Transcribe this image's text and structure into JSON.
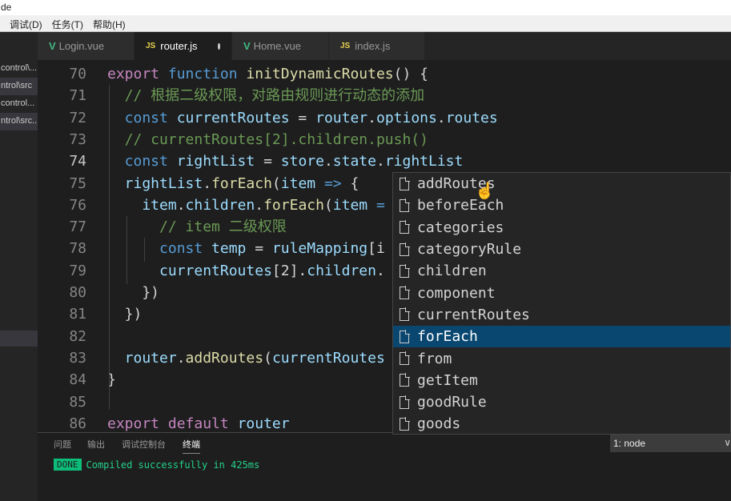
{
  "window": {
    "title": "de"
  },
  "menu": [
    "调试(D)",
    "任务(T)",
    "帮助(H)"
  ],
  "sidebar": [
    "control\\...",
    "ntrol\\src",
    "control...",
    "ntrol\\src..",
    "",
    ""
  ],
  "tabs": [
    {
      "label": "Login.vue",
      "icon": "vue-icon"
    },
    {
      "label": "router.js",
      "icon": "js-icon",
      "active": true,
      "modified": true
    },
    {
      "label": "Home.vue",
      "icon": "vue-icon"
    },
    {
      "label": "index.js",
      "icon": "js-icon"
    }
  ],
  "code": [
    {
      "n": "70",
      "t": [
        [
          "export ",
          "kw"
        ],
        [
          "function ",
          "bl"
        ],
        [
          "initDynamicRoutes",
          "fn"
        ],
        [
          "() {",
          "pn"
        ]
      ]
    },
    {
      "n": "71",
      "t": [
        [
          "  // 根据二级权限，对路由规则进行动态的添加",
          "cm"
        ]
      ]
    },
    {
      "n": "72",
      "t": [
        [
          "  const ",
          "bl"
        ],
        [
          "currentRoutes",
          "vr"
        ],
        [
          " = ",
          "pn"
        ],
        [
          "router",
          "vr"
        ],
        [
          ".",
          "pn"
        ],
        [
          "options",
          "vr"
        ],
        [
          ".",
          "pn"
        ],
        [
          "routes",
          "vr"
        ]
      ]
    },
    {
      "n": "73",
      "t": [
        [
          "  // currentRoutes[2].children.push()",
          "cm"
        ]
      ]
    },
    {
      "n": "74",
      "t": [
        [
          "  const ",
          "bl"
        ],
        [
          "rightList",
          "vr"
        ],
        [
          " = ",
          "pn"
        ],
        [
          "store",
          "vr"
        ],
        [
          ".",
          "pn"
        ],
        [
          "state",
          "vr"
        ],
        [
          ".",
          "pn"
        ],
        [
          "rightList",
          "vr"
        ]
      ],
      "current": true
    },
    {
      "n": "75",
      "t": [
        [
          "  rightList",
          "vr"
        ],
        [
          ".",
          "pn"
        ],
        [
          "forEach",
          "fn"
        ],
        [
          "(",
          "pn"
        ],
        [
          "item",
          "vr"
        ],
        [
          " => ",
          "bl"
        ],
        [
          "{",
          "pn"
        ]
      ]
    },
    {
      "n": "76",
      "t": [
        [
          "    item",
          "vr"
        ],
        [
          ".",
          "pn"
        ],
        [
          "children",
          "vr"
        ],
        [
          ".",
          "pn"
        ],
        [
          "forEach",
          "fn"
        ],
        [
          "(",
          "pn"
        ],
        [
          "item",
          "vr"
        ],
        [
          " =",
          "bl"
        ]
      ]
    },
    {
      "n": "77",
      "t": [
        [
          "      // item 二级权限",
          "cm"
        ]
      ]
    },
    {
      "n": "78",
      "t": [
        [
          "      const ",
          "bl"
        ],
        [
          "temp",
          "vr"
        ],
        [
          " = ",
          "pn"
        ],
        [
          "ruleMapping",
          "vr"
        ],
        [
          "[i",
          "pn"
        ]
      ]
    },
    {
      "n": "79",
      "t": [
        [
          "      currentRoutes",
          "vr"
        ],
        [
          "[2].",
          "pn"
        ],
        [
          "children",
          "vr"
        ],
        [
          ".",
          "pn"
        ]
      ]
    },
    {
      "n": "80",
      "t": [
        [
          "    })",
          "pn"
        ]
      ]
    },
    {
      "n": "81",
      "t": [
        [
          "  })",
          "pn"
        ]
      ]
    },
    {
      "n": "82",
      "t": [
        [
          "",
          "pn"
        ]
      ]
    },
    {
      "n": "83",
      "t": [
        [
          "  router",
          "vr"
        ],
        [
          ".",
          "pn"
        ],
        [
          "addRoutes",
          "fn"
        ],
        [
          "(",
          "pn"
        ],
        [
          "currentRoutes",
          "vr"
        ]
      ]
    },
    {
      "n": "84",
      "t": [
        [
          "}",
          "pn"
        ]
      ]
    },
    {
      "n": "85",
      "t": [
        [
          "",
          "pn"
        ]
      ]
    },
    {
      "n": "86",
      "t": [
        [
          "export ",
          "kw"
        ],
        [
          "default ",
          "kw"
        ],
        [
          "router",
          "vr"
        ]
      ]
    }
  ],
  "autocomplete": {
    "items": [
      "addRoutes",
      "beforeEach",
      "categories",
      "categoryRule",
      "children",
      "component",
      "currentRoutes",
      "forEach",
      "from",
      "getItem",
      "goodRule",
      "goods"
    ],
    "selected": "forEach"
  },
  "panel": {
    "tabs": [
      "问题",
      "输出",
      "调试控制台",
      "终端"
    ],
    "active": "终端",
    "terminal_select": "1: node",
    "badge": "DONE",
    "message": "Compiled successfully in 425ms"
  }
}
